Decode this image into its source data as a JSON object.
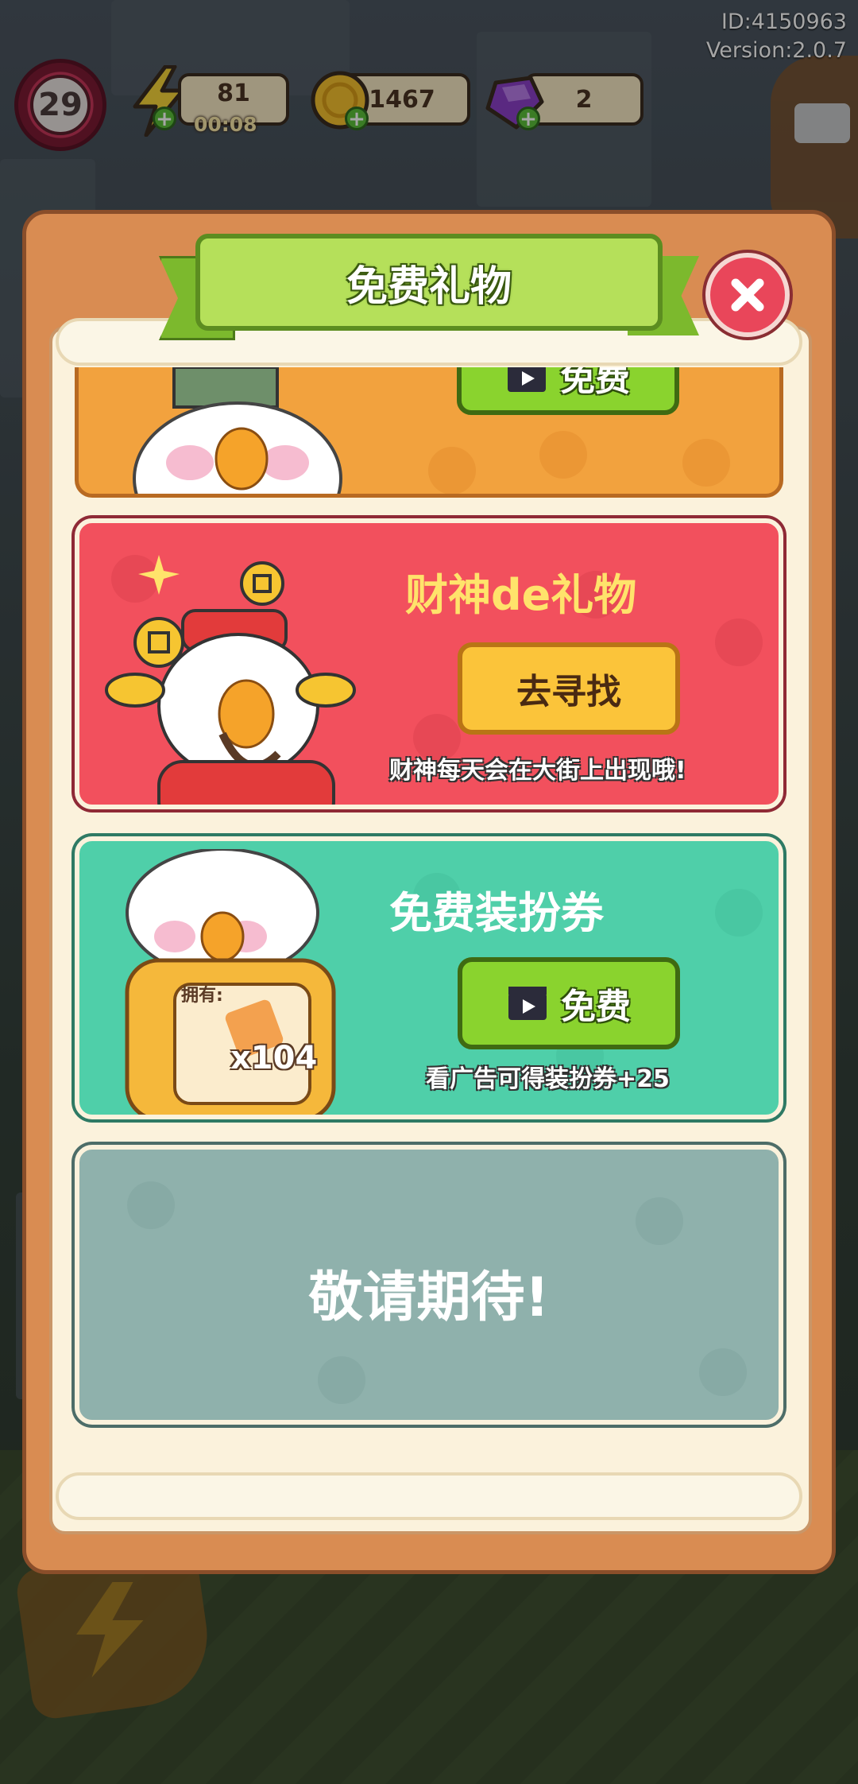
{
  "hud": {
    "id_label": "ID:4150963",
    "version_label": "Version:2.0.7",
    "level": "29",
    "energy": "81",
    "energy_timer": "00:08",
    "coins": "1467",
    "gems": "2"
  },
  "dialog": {
    "title": "免费礼物",
    "cards": [
      {
        "button": "免费"
      },
      {
        "title": "财神de礼物",
        "button": "去寻找",
        "subtext": "财神每天会在大街上出现哦!"
      },
      {
        "title": "免费装扮券",
        "button": "免费",
        "owned_label": "拥有:",
        "owned_count": "x104",
        "subtext": "看广告可得装扮券+25"
      },
      {
        "title": "敬请期待!"
      }
    ]
  },
  "colors": {
    "panel": "#d98c52",
    "card_orange": "#f2a23e",
    "card_red": "#f2505d",
    "card_teal": "#4fcfa9",
    "card_grey": "#8fb1ac",
    "button_green": "#8ad32e",
    "button_yellow": "#fbc43a"
  }
}
